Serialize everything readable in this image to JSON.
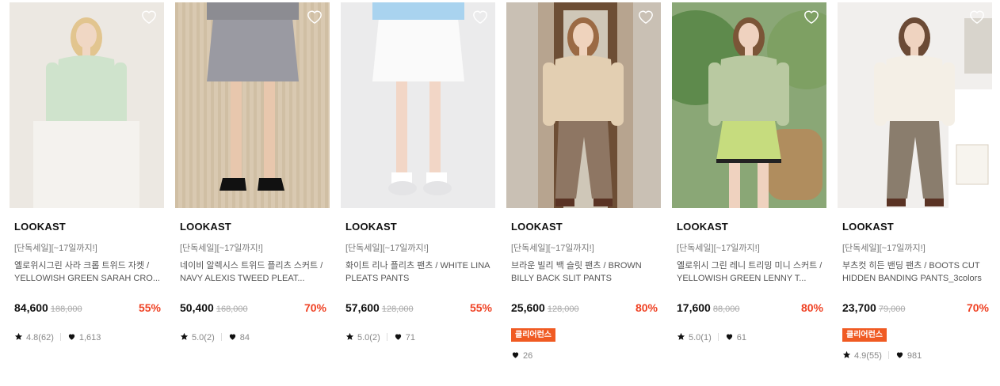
{
  "products": [
    {
      "brand": "LOOKAST",
      "promo": "[단독세일][~17일까지!]",
      "name": "옐로위시그린 사라 크롭 트위드 자켓 / YELLOWISH GREEN SARAH CRO...",
      "price": "84,600",
      "original_price": "188,000",
      "discount": "55%",
      "badge": "",
      "rating": "4.8(62)",
      "likes": "1,613",
      "image_icon": "model-green-tweed-jacket",
      "colors": {
        "bg": "#ece8e2",
        "top": "#cfe3cc",
        "bottom": "#f4f2ee",
        "skin": "#f0d7c4",
        "hair": "#e2c58f"
      }
    },
    {
      "brand": "LOOKAST",
      "promo": "[단독세일][~17일까지!]",
      "name": "네이비 알렉시스 트위드 플리츠 스커트 / NAVY ALEXIS TWEED PLEAT...",
      "price": "50,400",
      "original_price": "168,000",
      "discount": "70%",
      "badge": "",
      "rating": "5.0(2)",
      "likes": "84",
      "image_icon": "model-navy-tweed-skirt",
      "colors": {
        "bg": "#d9c9b1",
        "top": "#8c8c92",
        "bottom": "#9a9aa2",
        "skin": "#e8c7ad",
        "hair": "#d9c9b1"
      }
    },
    {
      "brand": "LOOKAST",
      "promo": "[단독세일][~17일까지!]",
      "name": "화이트 리나 플리츠 팬츠 / WHITE LINA PLEATS PANTS",
      "price": "57,600",
      "original_price": "128,000",
      "discount": "55%",
      "badge": "",
      "rating": "5.0(2)",
      "likes": "71",
      "image_icon": "model-white-pleats-pants",
      "colors": {
        "bg": "#ebebec",
        "top": "#a9d3ef",
        "bottom": "#fafafa",
        "skin": "#f2d6c6",
        "hair": "#ebebec"
      }
    },
    {
      "brand": "LOOKAST",
      "promo": "[단독세일][~17일까지!]",
      "name": "브라운 빌리 백 슬릿 팬츠 / BROWN BILLY BACK SLIT PANTS",
      "price": "25,600",
      "original_price": "128,000",
      "discount": "80%",
      "badge": "클리어런스",
      "rating": "",
      "likes": "26",
      "image_icon": "model-brown-slit-pants",
      "colors": {
        "bg": "#b7a48f",
        "top": "#e3cfb2",
        "bottom": "#8e7663",
        "skin": "#efd3bd",
        "hair": "#9b6a44"
      }
    },
    {
      "brand": "LOOKAST",
      "promo": "[단독세일][~17일까지!]",
      "name": "옐로위시 그린 레니 트리밍 미니 스커트 / YELLOWISH GREEN LENNY T...",
      "price": "17,600",
      "original_price": "88,000",
      "discount": "80%",
      "badge": "",
      "rating": "5.0(1)",
      "likes": "61",
      "image_icon": "model-green-mini-skirt",
      "colors": {
        "bg": "#8aa776",
        "top": "#b9c9a1",
        "bottom": "#c6dc7e",
        "skin": "#efd2bf",
        "hair": "#7b5537"
      }
    },
    {
      "brand": "LOOKAST",
      "promo": "[단독세일][~17일까지!]",
      "name": "부츠컷 히든 밴딩 팬츠 / BOOTS CUT HIDDEN BANDING PANTS_3colors",
      "price": "23,700",
      "original_price": "79,000",
      "discount": "70%",
      "badge": "클리어런스",
      "rating": "4.9(55)",
      "likes": "981",
      "image_icon": "model-brown-bootcut-pants",
      "colors": {
        "bg": "#f1efed",
        "top": "#f4efe6",
        "bottom": "#8a7d6d",
        "skin": "#efd3c0",
        "hair": "#6b4a35"
      }
    }
  ]
}
